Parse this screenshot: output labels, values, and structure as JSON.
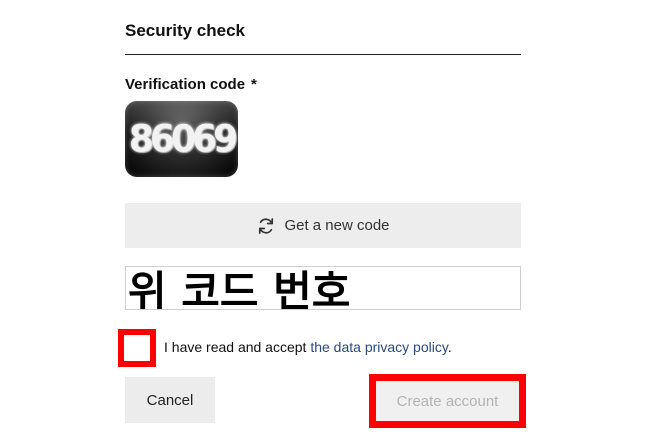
{
  "security_check": {
    "title": "Security check",
    "verification_label": "Verification code",
    "required_marker": "*",
    "captcha_text": "86069",
    "new_code_label": "Get a new code",
    "code_input_value": "위 코드 번호"
  },
  "consent": {
    "text": "I have read and accept ",
    "link_text": "the data privacy policy",
    "suffix": ".",
    "checked": false
  },
  "actions": {
    "cancel_label": "Cancel",
    "create_label": "Create account"
  },
  "colors": {
    "highlight": "#ff0000",
    "link": "#2b4a7a",
    "button_bg": "#ededed",
    "disabled_text": "#b3b3b3"
  },
  "icons": {
    "refresh": "refresh-icon"
  }
}
